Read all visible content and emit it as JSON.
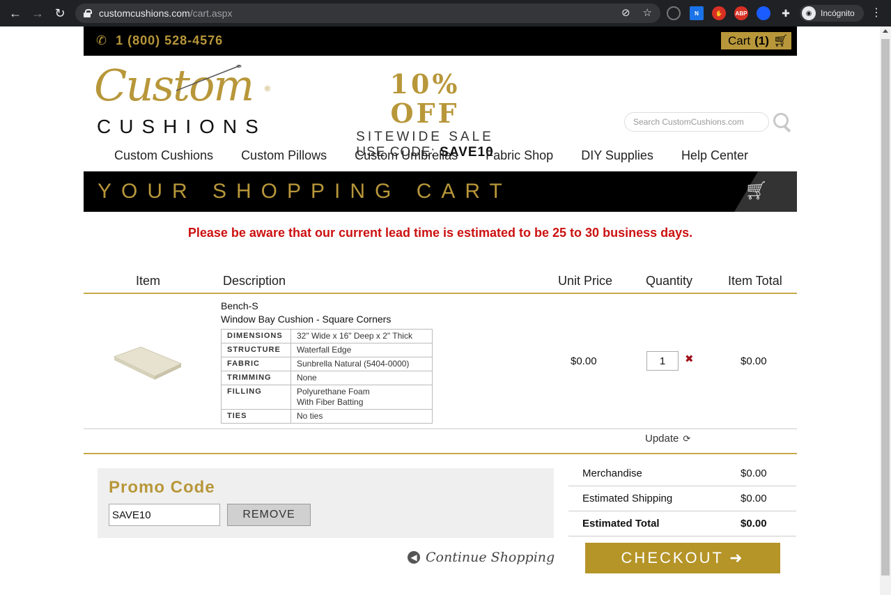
{
  "browser": {
    "url_host": "customcushions.com",
    "url_path": "/cart.aspx",
    "profile_label": "Incógnito"
  },
  "topbar": {
    "phone": "1 (800) 528-4576",
    "cart_label": "Cart",
    "cart_count": "(1)"
  },
  "logo": {
    "script": "Custom",
    "word": "CUSHIONS",
    "registered": "®"
  },
  "promo_banner": {
    "headline": "10% OFF",
    "subline": "SITEWIDE SALE",
    "code_prefix": "USE CODE:",
    "code": "SAVE10"
  },
  "search": {
    "placeholder": "Search CustomCushions.com"
  },
  "nav": {
    "items": [
      "Custom Cushions",
      "Custom Pillows",
      "Custom Umbrellas",
      "Fabric Shop",
      "DIY Supplies",
      "Help Center"
    ]
  },
  "cart_header": {
    "title": "YOUR SHOPPING CART"
  },
  "notice": "Please be aware that our current lead time is estimated to be 25 to 30 business days.",
  "table_headers": {
    "item": "Item",
    "description": "Description",
    "unit_price": "Unit Price",
    "quantity": "Quantity",
    "item_total": "Item Total"
  },
  "cart_item": {
    "sku": "Bench-S",
    "name": "Window Bay Cushion - Square Corners",
    "specs": [
      {
        "key": "DIMENSIONS",
        "value": "32\" Wide  x  16\" Deep  x  2\" Thick"
      },
      {
        "key": "STRUCTURE",
        "value": "Waterfall Edge"
      },
      {
        "key": "FABRIC",
        "value": "Sunbrella Natural (5404-0000)"
      },
      {
        "key": "TRIMMING",
        "value": "None"
      },
      {
        "key": "FILLING",
        "value": "Polyurethane Foam",
        "value2": "With Fiber Batting"
      },
      {
        "key": "TIES",
        "value": "No ties"
      }
    ],
    "unit_price": "$0.00",
    "quantity": "1",
    "remove_symbol": "✖",
    "item_total": "$0.00"
  },
  "update_label": "Update",
  "promo": {
    "title": "Promo Code",
    "value": "SAVE10",
    "remove_label": "REMOVE"
  },
  "continue_label": "Continue Shopping",
  "summary": {
    "rows": [
      {
        "label": "Merchandise",
        "value": "$0.00"
      },
      {
        "label": "Estimated Shipping",
        "value": "$0.00"
      },
      {
        "label": "Estimated Total",
        "value": "$0.00"
      }
    ]
  },
  "checkout_label": "CHECKOUT",
  "colors": {
    "gold": "#b8973a",
    "notice_red": "#cc1111",
    "black": "#000000"
  }
}
